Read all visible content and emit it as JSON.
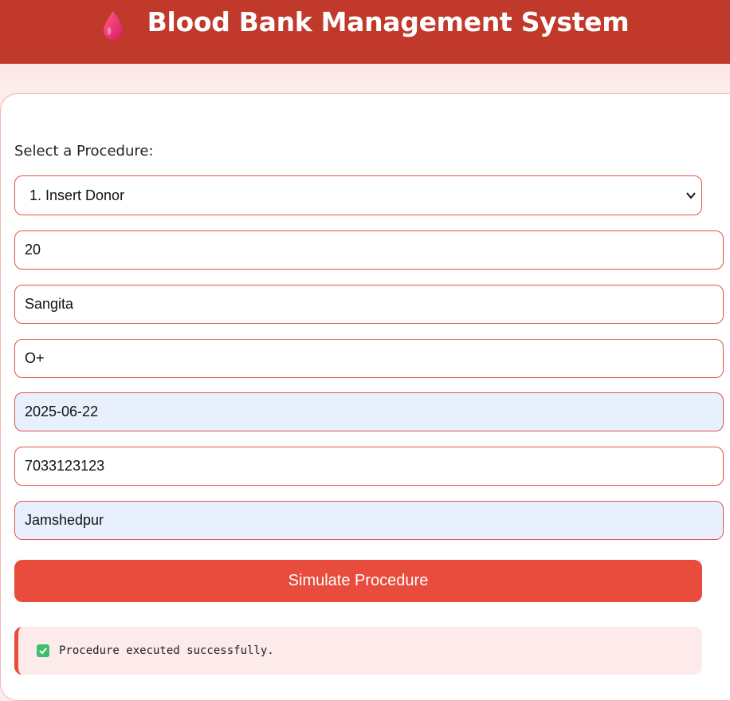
{
  "header": {
    "title": "Blood Bank Management System",
    "icon": "blood-drop-icon",
    "color": "#c0392b"
  },
  "form": {
    "procedure_label": "Select a Procedure:",
    "procedure_selected": "1. Insert Donor",
    "fields": {
      "donor_id": "20",
      "name": "Sangita",
      "blood_group": "O+",
      "donation_date": "2025-06-22",
      "phone": "7033123123",
      "city": "Jamshedpur"
    },
    "submit_label": "Simulate Procedure",
    "accent_color": "#e74c3c"
  },
  "result": {
    "icon": "check-mark-icon",
    "message": "Procedure executed successfully."
  }
}
